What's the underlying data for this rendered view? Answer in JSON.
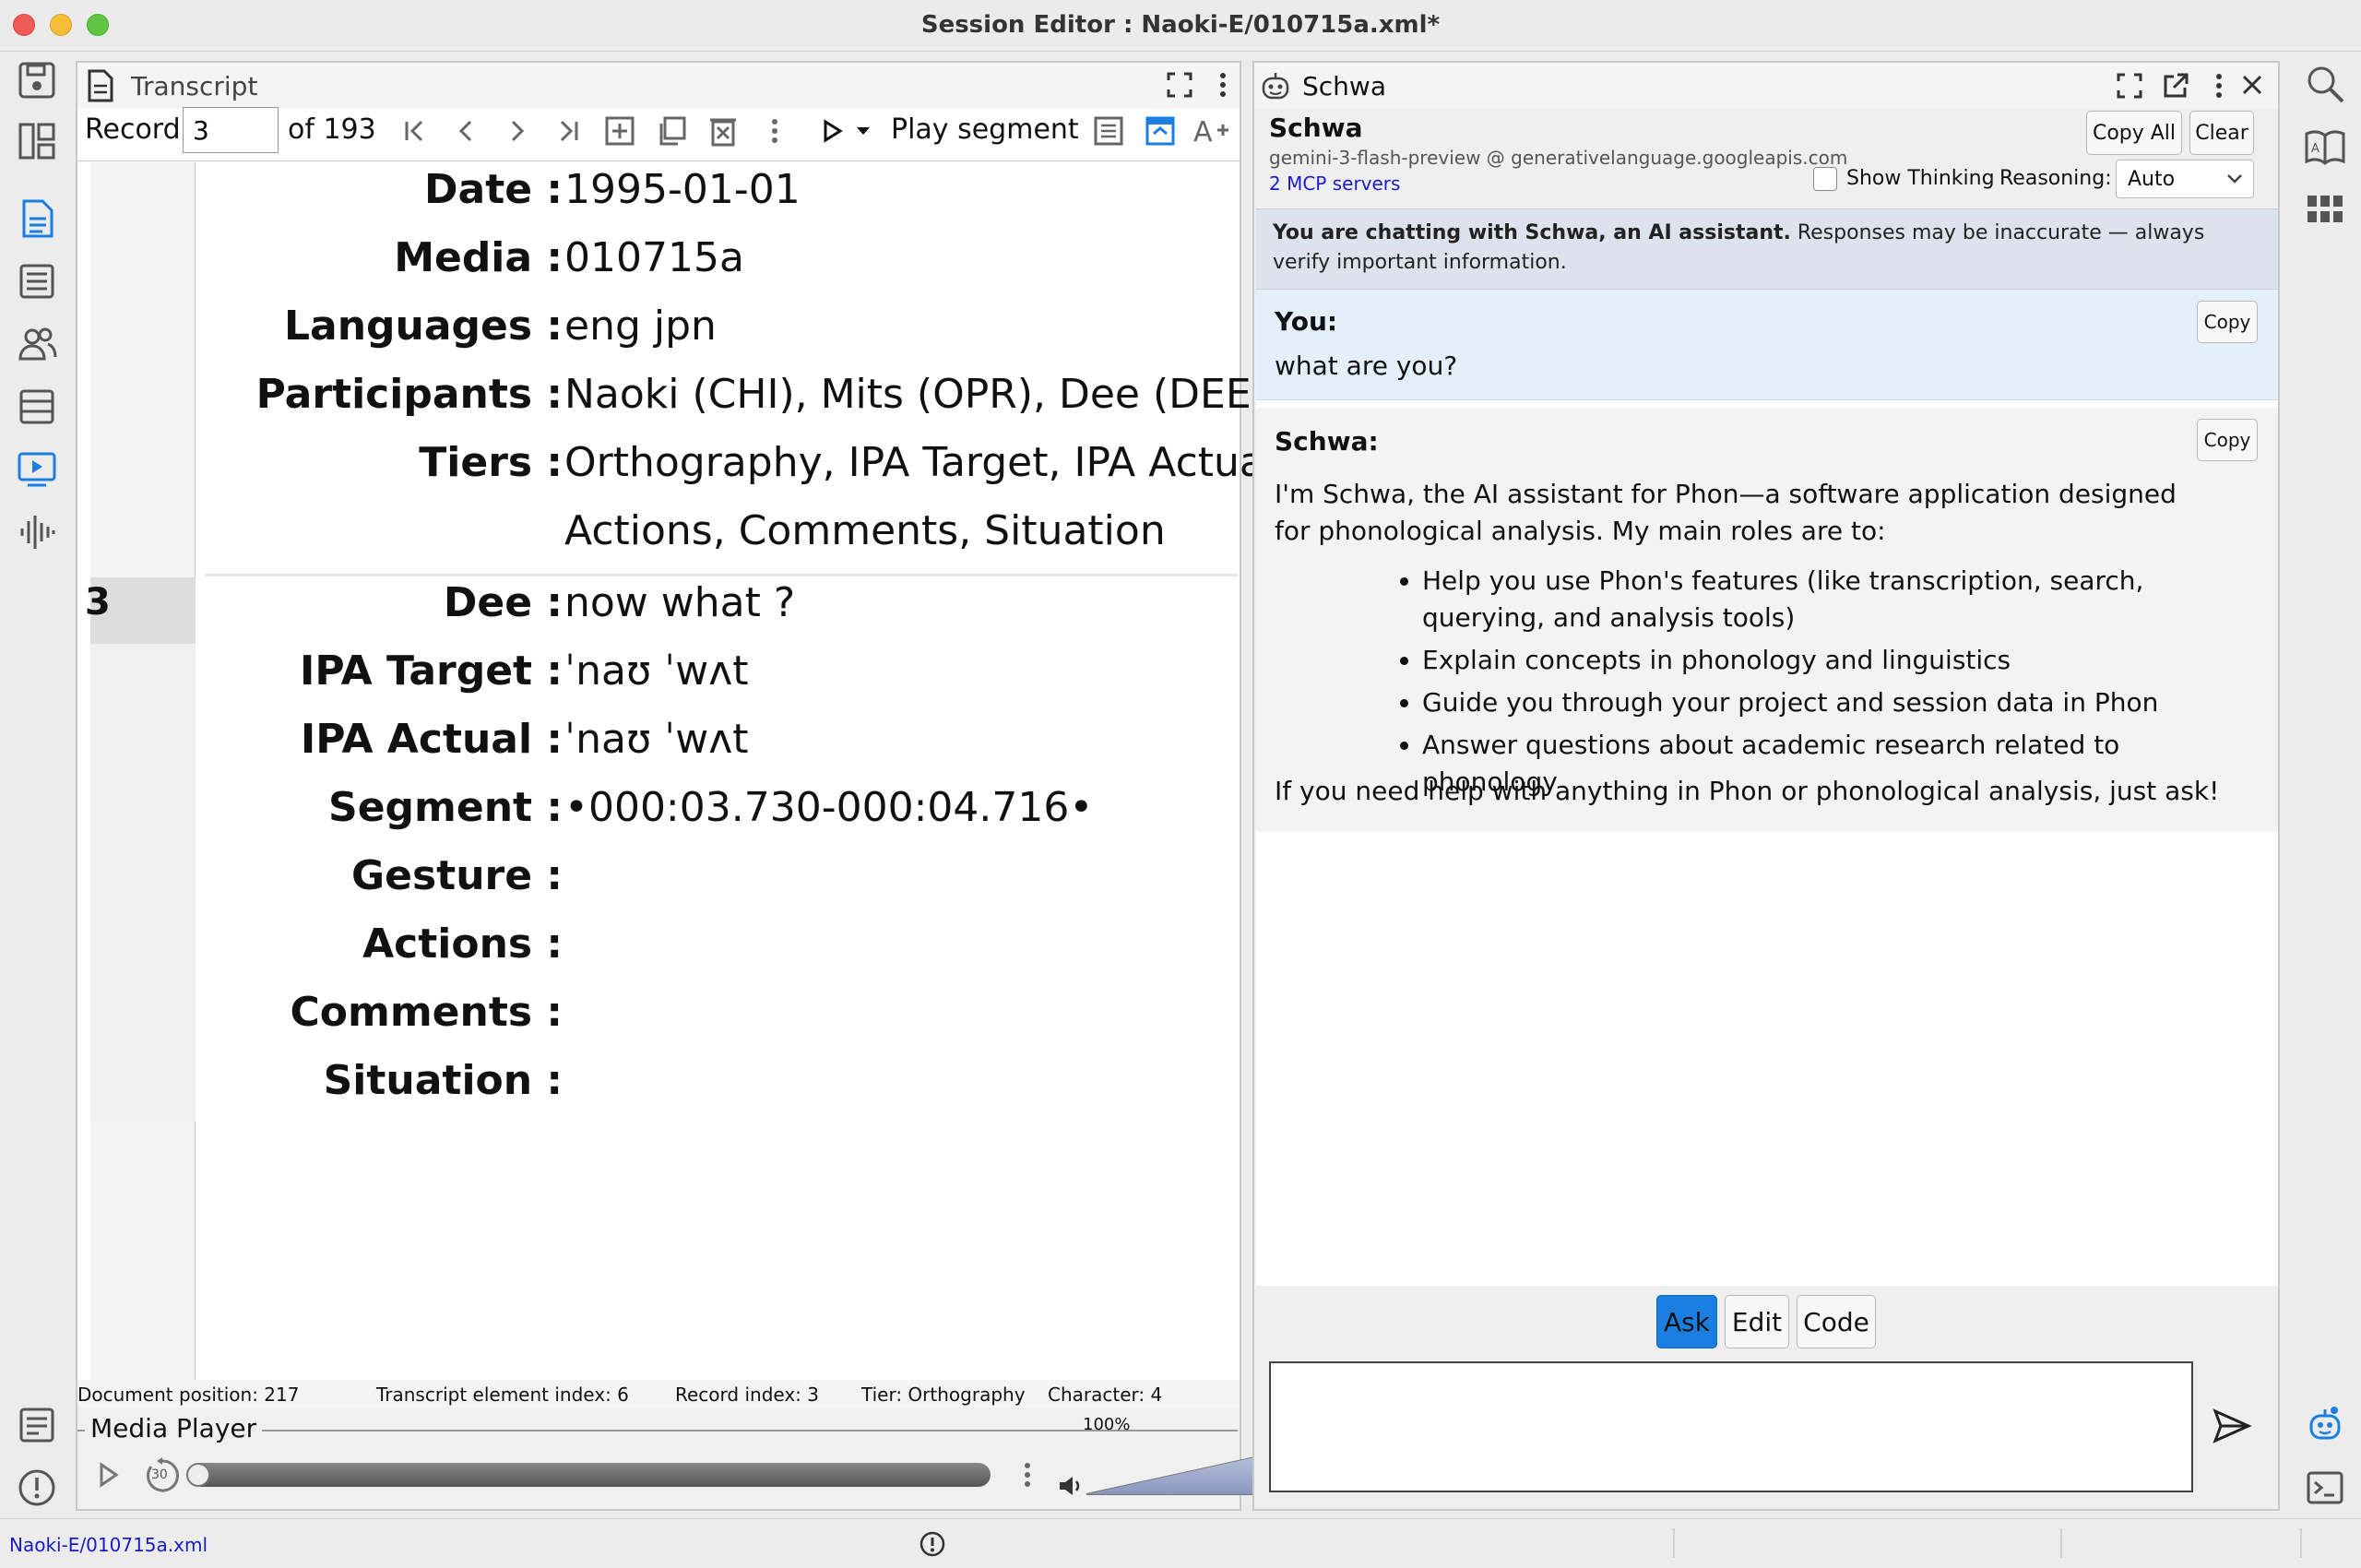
{
  "window": {
    "title": "Session Editor : Naoki-E/010715a.xml*"
  },
  "transcript": {
    "panel_title": "Transcript",
    "record_label": "Record:",
    "record_value": "3",
    "record_of": "of 193",
    "play_segment": "Play segment",
    "header_fields": [
      {
        "label": "Date :",
        "value": "1995-01-01"
      },
      {
        "label": "Media :",
        "value": "010715a"
      },
      {
        "label": "Languages :",
        "value": "eng jpn"
      },
      {
        "label": "Participants :",
        "value": "Naoki (CHI), Mits (OPR), Dee (DEE), M"
      },
      {
        "label": "Tiers :",
        "value": "Orthography, IPA Target, IPA Actua",
        "value2": "Actions, Comments, Situation"
      }
    ],
    "record_number": "3",
    "record_fields": [
      {
        "label": "Dee :",
        "value": "now what ?"
      },
      {
        "label": "IPA Target :",
        "value": "ˈnaʊ ˈwʌt"
      },
      {
        "label": "IPA Actual :",
        "value": "ˈnaʊ ˈwʌt"
      },
      {
        "label": "Segment :",
        "value": "•000:03.730-000:04.716•"
      },
      {
        "label": "Gesture :",
        "value": ""
      },
      {
        "label": "Actions :",
        "value": ""
      },
      {
        "label": "Comments :",
        "value": ""
      },
      {
        "label": "Situation :",
        "value": ""
      }
    ],
    "status": {
      "document_position": "Document position: 217",
      "element_index": "Transcript element index: 6",
      "record_index": "Record index: 3",
      "tier": "Tier: Orthography",
      "character": "Character: 4"
    }
  },
  "media_player": {
    "title": "Media Player",
    "volume": "100%",
    "volume_level": 1.0,
    "skip_seconds": "30"
  },
  "schwa": {
    "panel_title": "Schwa",
    "name": "Schwa",
    "model": "gemini-3-flash-preview @ generativelanguage.googleapis.com",
    "mcp": "2 MCP servers",
    "copy_all": "Copy All",
    "clear": "Clear",
    "show_thinking": "Show Thinking",
    "reasoning_label": "Reasoning:",
    "reasoning_value": "Auto",
    "notice_bold": "You are chatting with Schwa, an AI assistant.",
    "notice_rest": " Responses may be inaccurate — always verify important information.",
    "messages": [
      {
        "sender": "You:",
        "text": "what are you?",
        "copy": "Copy"
      },
      {
        "sender": "Schwa:",
        "copy": "Copy",
        "intro": "I'm Schwa, the AI assistant for Phon—a software application designed for phonological analysis. My main roles are to:",
        "bullets": [
          "Help you use Phon's features (like transcription, search, querying, and analysis tools)",
          "Explain concepts in phonology and linguistics",
          "Guide you through your project and session data in Phon",
          "Answer questions about academic research related to phonology"
        ],
        "outro": "If you need help with anything in Phon or phonological analysis, just ask!"
      }
    ],
    "modes": [
      "Ask",
      "Edit",
      "Code"
    ],
    "input_placeholder": ""
  },
  "statusbar": {
    "file": "Naoki-E/010715a.xml"
  },
  "colors": {
    "accent": "#1a7fe0",
    "link": "#1a1acc",
    "notice_bg": "#dce3ec",
    "you_bg": "#e3f0fb"
  }
}
